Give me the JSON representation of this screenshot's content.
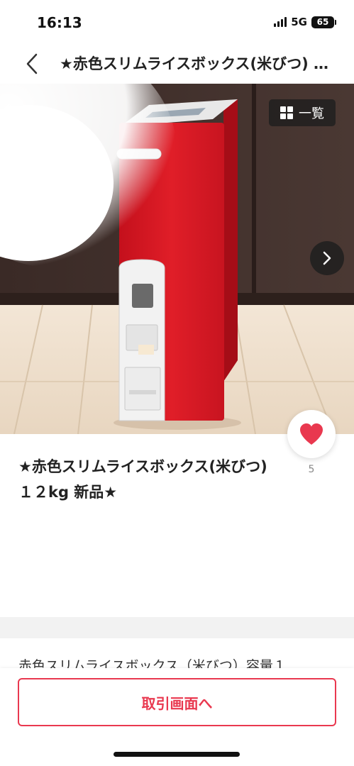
{
  "status_bar": {
    "time": "16:13",
    "network": "5G",
    "battery": "65"
  },
  "nav": {
    "title": "★赤色スリムライスボックス(米びつ) １２kg 新品★",
    "back_icon": "chevron-left-icon"
  },
  "gallery": {
    "list_label": "一覧",
    "list_icon": "grid-icon",
    "next_icon": "chevron-right-icon"
  },
  "like": {
    "icon": "heart-icon",
    "count": "5",
    "color": "#e9384f"
  },
  "item": {
    "title": "★赤色スリムライスボックス(米びつ) １２kg 新品★",
    "description": "赤色スリムライスボックス（米びつ）容量１"
  },
  "actions": {
    "trade_label": "取引画面へ",
    "accent_color": "#e9384f"
  }
}
